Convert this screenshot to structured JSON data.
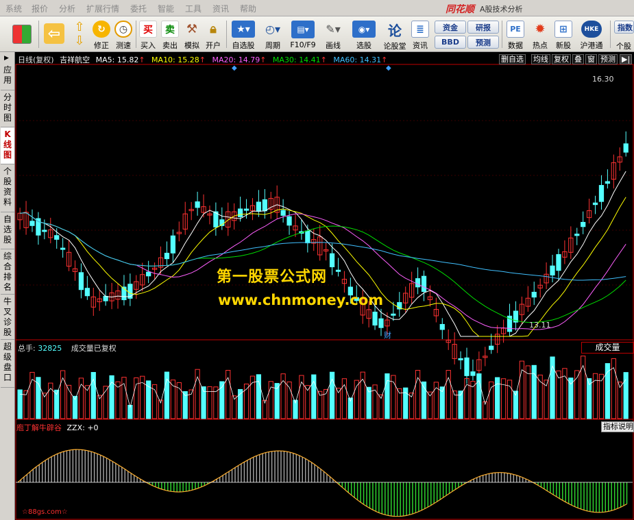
{
  "menu": {
    "items": [
      "系统",
      "报价",
      "分析",
      "扩展行情",
      "委托",
      "智能",
      "工具",
      "资讯",
      "帮助"
    ],
    "brand": "同花顺",
    "app_title": "A股技术分析"
  },
  "toolbar": {
    "buttons": [
      {
        "label": "",
        "icon": "grid-icon"
      },
      {
        "label": "",
        "icon": "back-arrow-icon"
      },
      {
        "label": "",
        "icon": "up-down-arrows-icon"
      },
      {
        "label": "修正",
        "icon": "refresh-icon"
      },
      {
        "label": "测速",
        "icon": "clock-icon"
      },
      {
        "label": "买入",
        "icon": "buy-icon"
      },
      {
        "label": "卖出",
        "icon": "sell-icon"
      },
      {
        "label": "模拟",
        "icon": "hammer-icon"
      },
      {
        "label": "开户",
        "icon": "lock-icon"
      },
      {
        "label": "自选股",
        "icon": "star-icon"
      },
      {
        "label": "周期",
        "icon": "cycle-icon"
      },
      {
        "label": "F10/F9",
        "icon": "f10-icon"
      },
      {
        "label": "画线",
        "icon": "pencil-icon"
      },
      {
        "label": "选股",
        "icon": "select-stock-icon"
      },
      {
        "label": "论股堂",
        "icon": "forum-icon"
      },
      {
        "label": "资讯",
        "icon": "news-icon"
      },
      {
        "label": "数据",
        "icon": "pe-icon"
      },
      {
        "label": "热点",
        "icon": "hot-icon"
      },
      {
        "label": "新股",
        "icon": "new-stock-icon"
      },
      {
        "label": "沪港通",
        "icon": "hk-connect-icon"
      },
      {
        "label": "个股",
        "icon": "stock-icon"
      }
    ],
    "small_buttons": {
      "fund": "资金",
      "research": "研报",
      "bbd": "BBD",
      "forecast": "预测",
      "index": "指数"
    }
  },
  "icons": {
    "buy_glyph": "买",
    "sell_glyph": "卖",
    "forum_glyph": "论",
    "pe_glyph": "PE",
    "hk_glyph": "HKE"
  },
  "left_tabs": [
    "应用",
    "分时图",
    "K线图",
    "个股资料",
    "自选股",
    "综合排名",
    "牛叉诊股",
    "超级盘口"
  ],
  "kline": {
    "period": "日线(复权)",
    "stock_name": "吉祥航空",
    "ma": [
      {
        "label": "MA5:",
        "value": "15.82",
        "color": "#ffffff"
      },
      {
        "label": "MA10:",
        "value": "15.28",
        "color": "#ffff00"
      },
      {
        "label": "MA20:",
        "value": "14.79",
        "color": "#ff60ff"
      },
      {
        "label": "MA30:",
        "value": "14.41",
        "color": "#00e000"
      },
      {
        "label": "MA60:",
        "value": "14.31",
        "color": "#40c0ff"
      }
    ],
    "up_arrow": "↑",
    "right_buttons": [
      "删自选",
      "均线",
      "复权",
      "叠",
      "窗",
      "预测",
      "▶|"
    ],
    "high_label": "16.30",
    "low_label": "13.11",
    "cai_marker": "财"
  },
  "volume": {
    "label": "总手:",
    "value": "32825",
    "note": "成交量已复权",
    "title_box": "成交量"
  },
  "indicator": {
    "name": "庖丁解牛辟谷",
    "zzx_label": "ZZX:",
    "zzx_value": "+0",
    "help_button": "指标说明"
  },
  "watermark": {
    "line1": "第一股票公式网",
    "line2": "www.chnmoney.com",
    "footer": "☆88gs.com☆"
  },
  "colors": {
    "up_candle": "#ff3232",
    "down_candle": "#54ffff",
    "ma5": "#ffffff",
    "ma10": "#ffff00",
    "ma20": "#ff60ff",
    "ma30": "#00e000",
    "ma60": "#40c0ff",
    "border": "#c00000"
  }
}
